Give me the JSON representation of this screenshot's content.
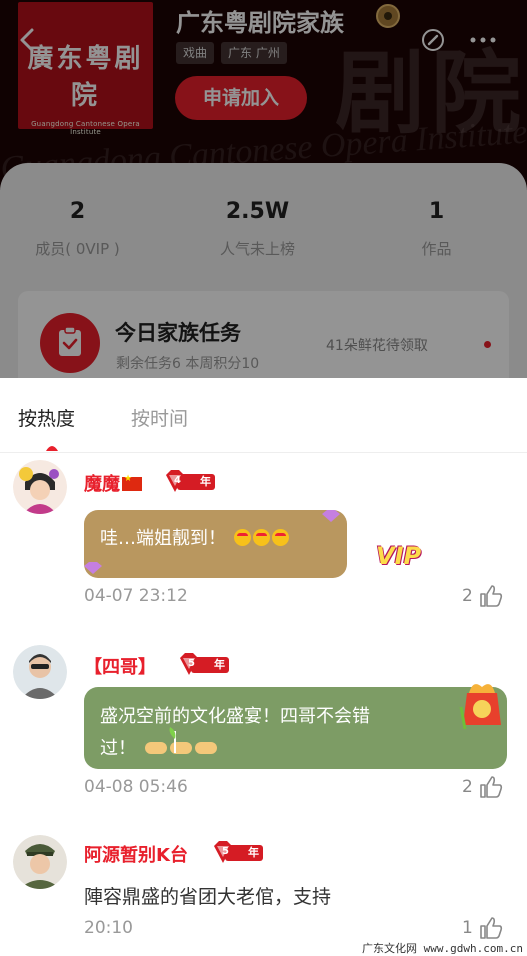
{
  "header": {
    "family_name": "广东粤剧院家族",
    "logo_main": "廣东粤剧院",
    "logo_sub": "Guangdong Cantonese Opera Institute",
    "tags": [
      "戏曲",
      "广东 广州"
    ],
    "join_label": "申请加入",
    "icons": {
      "back": "chevron-left-icon",
      "compass": "compass-icon",
      "more": "more-dots-icon",
      "badge": "family-level-badge"
    }
  },
  "stats": [
    {
      "value": "2",
      "label": "成员( 0VIP )"
    },
    {
      "value": "2.5W",
      "label": "人气未上榜"
    },
    {
      "value": "1",
      "label": "作品"
    }
  ],
  "task": {
    "title": "今日家族任务",
    "sub": "剩余任务6  本周积分10",
    "flower": "41朵鲜花待领取",
    "icon": "clipboard-check-icon",
    "accent": "#e8202c"
  },
  "sort_tabs": {
    "hot": "按热度",
    "time": "按时间"
  },
  "comments": [
    {
      "user": "魔魔",
      "badge_num": "4",
      "badge_suffix": "年",
      "text": "哇…端姐靓到！",
      "time": "04-07 23:12",
      "likes": "2",
      "bubble": "gold"
    },
    {
      "user": "【四哥】",
      "badge_num": "5",
      "badge_suffix": "年",
      "text_line1": "盛况空前的文化盛宴！四哥不会错",
      "text_line2": "过！",
      "time": "04-08 05:46",
      "likes": "2",
      "bubble": "green"
    },
    {
      "user": "阿源暂别K台",
      "badge_num": "5",
      "badge_suffix": "年",
      "text": "陣容鼎盛的省团大老倌，支持",
      "time": "20:10",
      "likes": "1"
    }
  ],
  "decor": {
    "vip": "VIP"
  },
  "watermark": "广东文化网 www.gdwh.com.cn",
  "colors": {
    "accent": "#e8202c",
    "gold_bubble": "#b9975f",
    "green_bubble": "#7d9c65"
  }
}
